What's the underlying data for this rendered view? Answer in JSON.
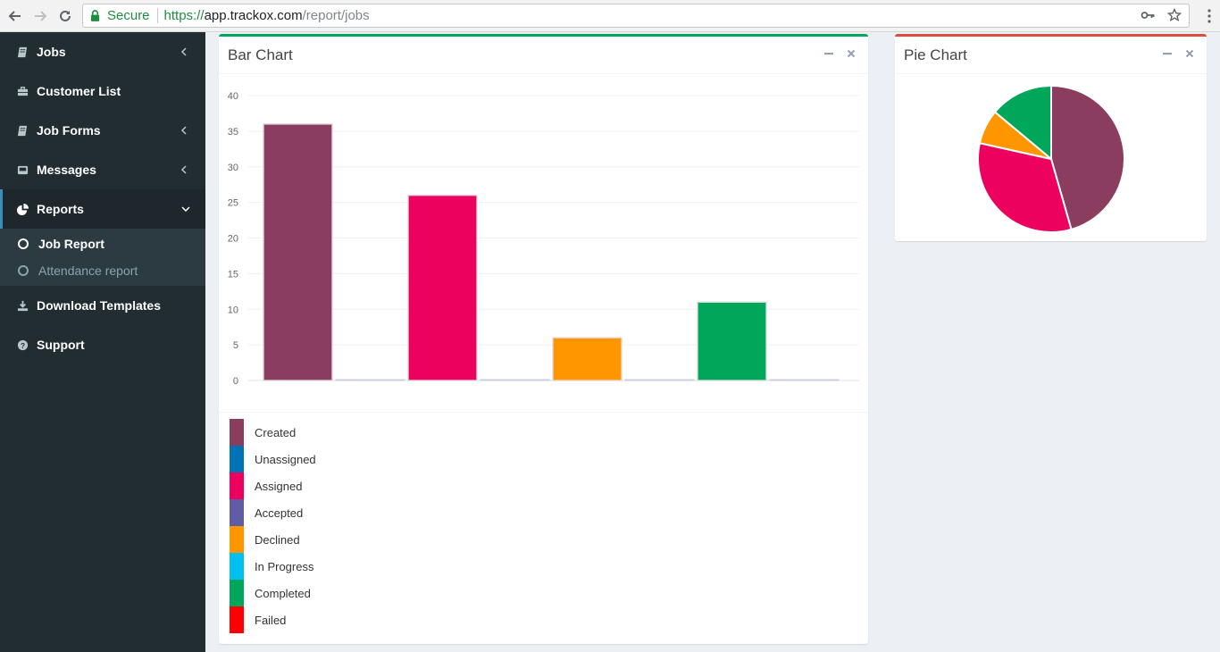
{
  "browser": {
    "secure_label": "Secure",
    "url_scheme": "https://",
    "url_host": "app.trackox.com",
    "url_path": "/report/jobs"
  },
  "sidebar": {
    "items": [
      {
        "label": "Jobs",
        "icon": "book-icon"
      },
      {
        "label": "Customer List",
        "icon": "briefcase-icon"
      },
      {
        "label": "Job Forms",
        "icon": "book-icon"
      },
      {
        "label": "Messages",
        "icon": "envelope-icon"
      },
      {
        "label": "Reports",
        "icon": "pie-chart-icon"
      },
      {
        "label": "Download Templates",
        "icon": "download-icon"
      },
      {
        "label": "Support",
        "icon": "question-circle-icon"
      }
    ],
    "submenu": [
      {
        "label": "Job Report"
      },
      {
        "label": "Attendance report"
      }
    ]
  },
  "bar_box": {
    "title": "Bar Chart",
    "accent": "#00a65a"
  },
  "pie_box": {
    "title": "Pie Chart",
    "accent": "#dd4b39"
  },
  "legend": [
    {
      "label": "Created",
      "color": "#8b3d5f"
    },
    {
      "label": "Unassigned",
      "color": "#0073b7"
    },
    {
      "label": "Assigned",
      "color": "#ec015f"
    },
    {
      "label": "Accepted",
      "color": "#605ca8"
    },
    {
      "label": "Declined",
      "color": "#ff9600"
    },
    {
      "label": "In Progress",
      "color": "#00c0ef"
    },
    {
      "label": "Completed",
      "color": "#00a65a"
    },
    {
      "label": "Failed",
      "color": "#ff0000"
    }
  ],
  "chart_data": [
    {
      "type": "bar",
      "title": "Bar Chart",
      "categories": [
        "Created",
        "Unassigned",
        "Assigned",
        "Accepted",
        "Declined",
        "In Progress",
        "Completed",
        "Failed"
      ],
      "values": [
        36,
        0,
        26,
        0,
        6,
        0,
        11,
        0
      ],
      "colors": [
        "#8b3d5f",
        "#0073b7",
        "#ec015f",
        "#605ca8",
        "#ff9600",
        "#00c0ef",
        "#00a65a",
        "#ff0000"
      ],
      "ylim": [
        0,
        40
      ],
      "yticks": [
        0,
        5,
        10,
        15,
        20,
        25,
        30,
        35,
        40
      ],
      "grid": true,
      "legend": "bottom"
    },
    {
      "type": "pie",
      "title": "Pie Chart",
      "categories": [
        "Created",
        "Assigned",
        "Declined",
        "Completed"
      ],
      "values": [
        36,
        26,
        6,
        11
      ],
      "colors": [
        "#8b3d5f",
        "#ec015f",
        "#ff9600",
        "#00a65a"
      ]
    }
  ]
}
